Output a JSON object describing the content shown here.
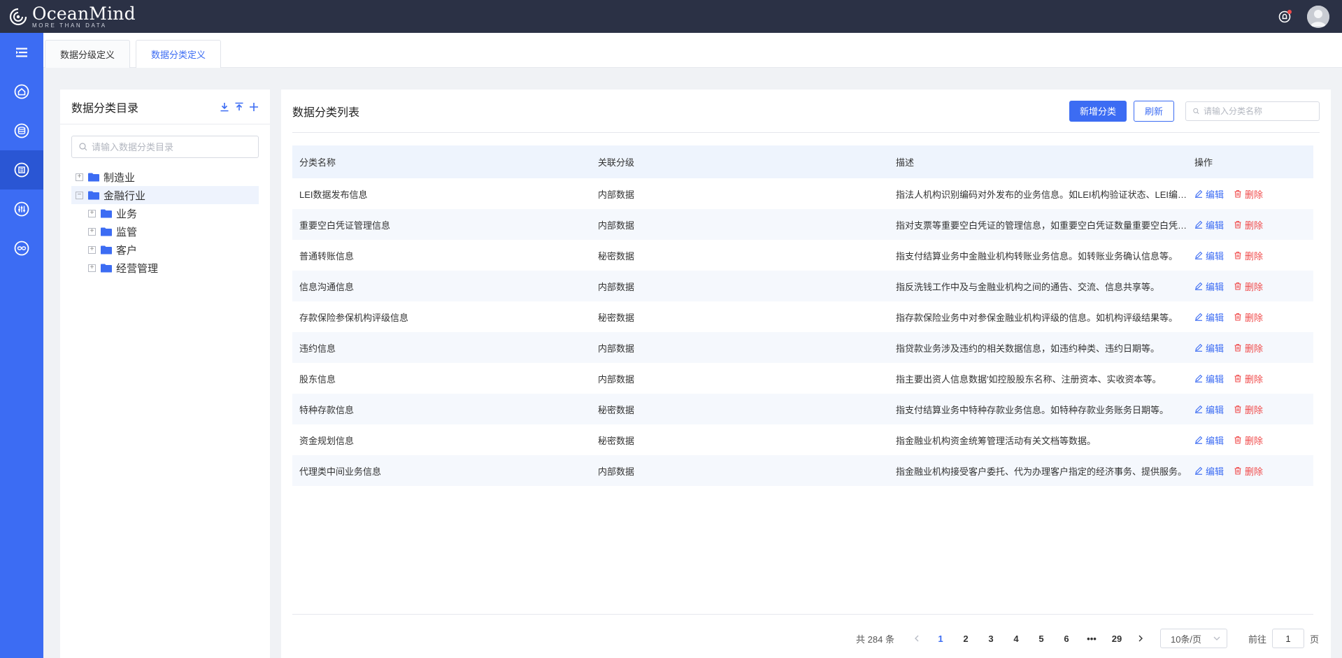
{
  "app": {
    "brand": "OceanMind",
    "tagline": "MORE THAN DATA"
  },
  "colors": {
    "topbar": "#2b3145",
    "rail": "#3c6cf3",
    "accent": "#3c6cf3",
    "danger": "#f04b4b"
  },
  "rail": {
    "items": [
      {
        "icon": "menu-toggle-icon"
      },
      {
        "icon": "home-icon"
      },
      {
        "icon": "database-icon"
      },
      {
        "icon": "shield-classify-icon",
        "active": true
      },
      {
        "icon": "sliders-icon"
      },
      {
        "icon": "link-icon"
      }
    ]
  },
  "tabs": [
    {
      "label": "数据分级定义"
    },
    {
      "label": "数据分类定义",
      "active": true
    }
  ],
  "tree": {
    "title": "数据分类目录",
    "search_placeholder": "请输入数据分类目录",
    "nodes": [
      {
        "label": "制造业",
        "expanded": false,
        "level": 0
      },
      {
        "label": "金融行业",
        "expanded": true,
        "level": 0,
        "selected": true
      },
      {
        "label": "业务",
        "expanded": false,
        "level": 1
      },
      {
        "label": "监管",
        "expanded": false,
        "level": 1
      },
      {
        "label": "客户",
        "expanded": false,
        "level": 1
      },
      {
        "label": "经营管理",
        "expanded": false,
        "level": 1
      }
    ]
  },
  "list": {
    "title": "数据分类列表",
    "add_button": "新增分类",
    "refresh_button": "刷新",
    "search_placeholder": "请输入分类名称",
    "columns": [
      "分类名称",
      "关联分级",
      "描述",
      "操作"
    ],
    "edit_label": "编辑",
    "delete_label": "删除",
    "rows": [
      {
        "name": "LEI数据发布信息",
        "level": "内部数据",
        "desc": "指法人机构识别编码对外发布的业务信息。如LEI机构验证状态、LEI编码等。"
      },
      {
        "name": "重要空白凭证管理信息",
        "level": "内部数据",
        "desc": "指对支票等重要空白凭证的管理信息，如重要空白凭证数量重要空白凭证号码等。"
      },
      {
        "name": "普通转账信息",
        "level": "秘密数据",
        "desc": "指支付结算业务中金融业机构转账业务信息。如转账业务确认信息等。"
      },
      {
        "name": "信息沟通信息",
        "level": "内部数据",
        "desc": "指反洗钱工作中及与金融业机构之间的通告、交流、信息共享等。"
      },
      {
        "name": "存款保险参保机构评级信息",
        "level": "秘密数据",
        "desc": "指存款保险业务中对参保金融业机构评级的信息。如机构评级结果等。"
      },
      {
        "name": "违约信息",
        "level": "内部数据",
        "desc": "指贷款业务涉及违约的相关数据信息，如违约种类、违约日期等。"
      },
      {
        "name": "股东信息",
        "level": "内部数据",
        "desc": "指主要出资人信息数据'如控股股东名称、注册资本、实收资本等。"
      },
      {
        "name": "特种存款信息",
        "level": "秘密数据",
        "desc": "指支付结算业务中特种存款业务信息。如特种存款业务账务日期等。"
      },
      {
        "name": "资金规划信息",
        "level": "秘密数据",
        "desc": "指金融业机构资金统筹管理活动有关文档等数据。"
      },
      {
        "name": "代理类中间业务信息",
        "level": "内部数据",
        "desc": "指金融业机构接受客户委托、代为办理客户指定的经济事务、提供服务。"
      }
    ]
  },
  "pagination": {
    "total_text": "共 284 条",
    "pages": [
      "1",
      "2",
      "3",
      "4",
      "5",
      "6",
      "•••",
      "29"
    ],
    "current": "1",
    "page_size": "10条/页",
    "goto_prefix": "前往",
    "goto_value": "1",
    "goto_suffix": "页"
  }
}
